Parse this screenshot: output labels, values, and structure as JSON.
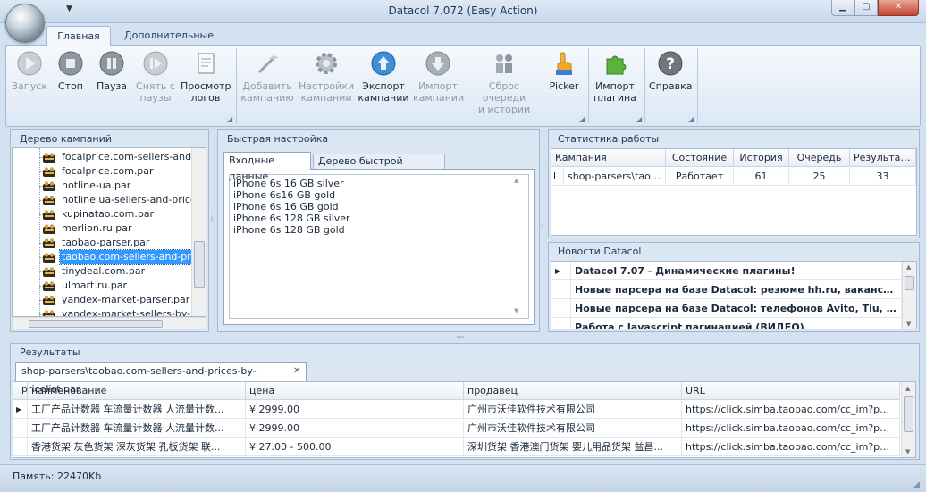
{
  "window": {
    "title": "Datacol 7.072 (Easy Action)",
    "min": "▁",
    "max": "▢",
    "close": "✕"
  },
  "ribbon": {
    "tabs": [
      "Главная",
      "Дополнительные"
    ],
    "buttons": {
      "start": "Запуск",
      "stop": "Стоп",
      "pause": "Пауза",
      "unpause1": "Снять с",
      "unpause2": "паузы",
      "logs1": "Просмотр",
      "logs2": "логов",
      "add1": "Добавить",
      "add2": "кампанию",
      "settings1": "Настройки",
      "settings2": "кампании",
      "export1": "Экспорт",
      "export2": "кампании",
      "import1": "Импорт",
      "import2": "кампании",
      "reset1": "Сброс очереди",
      "reset2": "и истории",
      "picker": "Picker",
      "importplugin1": "Импорт",
      "importplugin2": "плагина",
      "help": "Справка"
    }
  },
  "campaign_tree": {
    "title": "Дерево кампаний",
    "items": [
      "focalprice.com-sellers-and-pr",
      "focalprice.com.par",
      "hotline-ua.par",
      "hotline.ua-sellers-and-prices",
      "kupinatao.com.par",
      "merlion.ru.par",
      "taobao-parser.par",
      "taobao.com-sellers-and-price",
      "tinydeal.com.par",
      "ulmart.ru.par",
      "yandex-market-parser.par",
      "yandex-market-sellers-by-pr"
    ],
    "selected_index": 7
  },
  "quick_setup": {
    "title": "Быстрая настройка",
    "tabs": [
      "Входные данные",
      "Дерево быстрой настройки"
    ],
    "input_lines": [
      "iPhone 6s 16 GB silver",
      "iPhone 6s16 GB gold",
      "iPhone 6s 16 GB gold",
      "iPhone 6s 128 GB silver",
      "iPhone 6s 128 GB gold"
    ]
  },
  "stats": {
    "title": "Статистика работы",
    "columns": [
      "Кампания",
      "Состояние",
      "История",
      "Очередь",
      "Результаты"
    ],
    "row": [
      "shop-parsers\\taob...",
      "Работает",
      "61",
      "25",
      "33"
    ],
    "row_marker": "I"
  },
  "news": {
    "title": "Новости Datacol",
    "items": [
      "Datacol 7.07 - Динамические плагины!",
      "Новые парсера на базе Datacol: резюме hh.ru, вакансий hh.r...",
      "Новые парсера на базе Datacol: телефонов Avito, Tiu, конта...",
      "Работа с Javascript пагинацией (ВИДЕО)"
    ]
  },
  "results": {
    "title": "Результаты",
    "tab": "shop-parsers\\taobao.com-sellers-and-prices-by-pricelist.par",
    "tab_close": "✕",
    "columns": [
      "наименование",
      "цена",
      "продавец",
      "URL"
    ],
    "rows": [
      [
        "工厂产品计数器 车流量计数器 人流量计数...",
        "¥ 2999.00",
        "广州市沃佳软件技术有限公司",
        "https://click.simba.taobao.com/cc_im?p=iPhon..."
      ],
      [
        "工厂产品计数器 车流量计数器 人流量计数...",
        "¥ 2999.00",
        "广州市沃佳软件技术有限公司",
        "https://click.simba.taobao.com/cc_im?p=iPhon..."
      ],
      [
        "香港货架 灰色货架 深灰货架 孔板货架 联...",
        "¥ 27.00 - 500.00",
        "深圳货架 香港澳门货架 婴儿用品货架 益昌...",
        "https://click.simba.taobao.com/cc_im?p=iPhon..."
      ]
    ]
  },
  "status": {
    "memory": "Память: 22470Kb"
  },
  "colors": {
    "accent": "#3399ff",
    "close": "#c6452f",
    "ribbon": "#dce7f4"
  }
}
